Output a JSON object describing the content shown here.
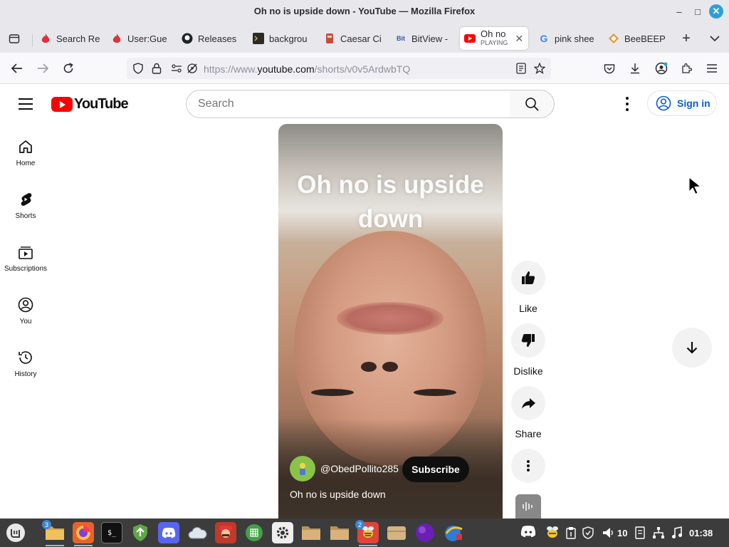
{
  "window": {
    "title": "Oh no is upside down - YouTube — Mozilla Firefox"
  },
  "tabs": [
    {
      "label": "Search Re",
      "icon": "fire-icon"
    },
    {
      "label": "User:Gue",
      "icon": "fire-icon"
    },
    {
      "label": "Releases",
      "icon": "github-icon"
    },
    {
      "label": "backgrou",
      "icon": "terminal-icon"
    },
    {
      "label": "Caesar Ci",
      "icon": "cipher-icon"
    },
    {
      "label": "BitView -",
      "icon": "bitview-icon"
    },
    {
      "label": "Oh no",
      "sub": "PLAYING",
      "icon": "youtube-icon",
      "active": true
    },
    {
      "label": "pink shee",
      "icon": "google-icon"
    },
    {
      "label": "BeeBEEP",
      "icon": "beebeep-icon"
    }
  ],
  "address_bar": {
    "url_prefix": "https://www.",
    "url_domain": "youtube.com",
    "url_path": "/shorts/v0v5ArdwbTQ"
  },
  "youtube": {
    "logo_text": "YouTube",
    "search_placeholder": "Search",
    "sign_in": "Sign in",
    "sidebar": [
      {
        "label": "Home",
        "icon": "home-icon"
      },
      {
        "label": "Shorts",
        "icon": "shorts-icon"
      },
      {
        "label": "Subscriptions",
        "icon": "subscriptions-icon"
      },
      {
        "label": "You",
        "icon": "you-icon"
      },
      {
        "label": "History",
        "icon": "history-icon"
      }
    ],
    "short": {
      "overlay_text": "Oh no is upside down",
      "channel_handle": "@ObedPollito285",
      "subscribe": "Subscribe",
      "title": "Oh no is upside down"
    },
    "actions": {
      "like": "Like",
      "dislike": "Dislike",
      "share": "Share"
    }
  },
  "taskbar": {
    "files_badge": "3",
    "beebeep_badge": "2",
    "volume_level": "10",
    "clock": "01:38"
  },
  "colors": {
    "youtube_red": "#ff0000",
    "sign_in_blue": "#065fd4",
    "taskbar": "#3c3c3c"
  }
}
